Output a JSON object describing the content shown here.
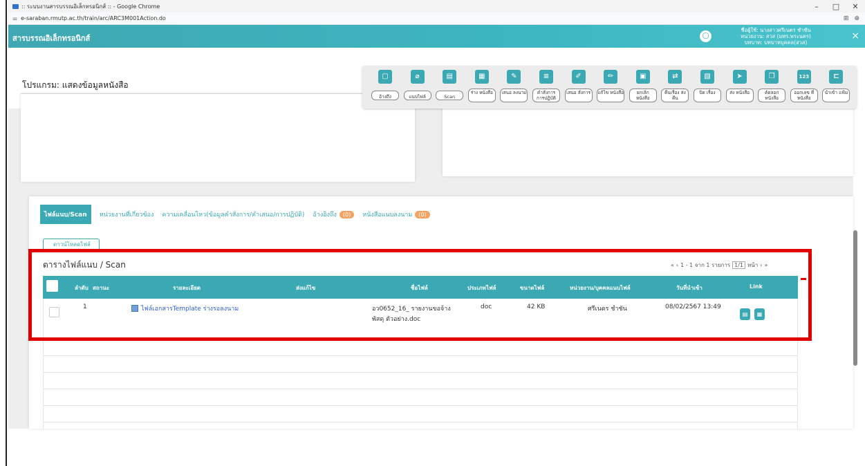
{
  "browser": {
    "title": ":: ระบบงานสารบรรณอิเล็กทรอนิกส์ :: - Google Chrome",
    "url": "e-saraban.rmutp.ac.th/train/arc/ARC3M001Action.do"
  },
  "app": {
    "title": "สารบรรณอิเล็กทรอนิกส์",
    "user_line1": "ชื่อผู้ใช้: นางสาวศรีเนตร ชำชัน",
    "user_line2": "หน่วยงาน: สวส (มทร.พระนคร)",
    "user_line3": "บทบาท: บทบาทบุคคล(สวส)",
    "close": "×"
  },
  "program": {
    "title": "โปรแกรม: แสดงข้อมูลหนังสือ"
  },
  "toolbar": [
    {
      "icon": "copy-icon",
      "glyph": "▢",
      "label": "อ้างถึง"
    },
    {
      "icon": "paperclip-icon",
      "glyph": "⌀",
      "label": "แนบไฟล์"
    },
    {
      "icon": "scan-icon",
      "glyph": "▤",
      "label": "Scan"
    },
    {
      "icon": "document-icon",
      "glyph": "▦",
      "label": "ร่าง หนังสือ"
    },
    {
      "icon": "sign-icon",
      "glyph": "✎",
      "label": "เสนอ ลงนาม"
    },
    {
      "icon": "order-icon",
      "glyph": "≡",
      "label": "คำสั่งการ การปฏิบัติ"
    },
    {
      "icon": "propose-icon",
      "glyph": "✐",
      "label": "เสนอ สั่งการ"
    },
    {
      "icon": "edit-icon",
      "glyph": "✏",
      "label": "แก้ไข หนังสือ"
    },
    {
      "icon": "cancel-doc-icon",
      "glyph": "▣",
      "label": "ยกเลิก หนังสือ"
    },
    {
      "icon": "return-icon",
      "glyph": "⇄",
      "label": "คืนเรื่อง ส่งคืน"
    },
    {
      "icon": "close-doc-icon",
      "glyph": "▧",
      "label": "ปิด เรื่อง"
    },
    {
      "icon": "send-icon",
      "glyph": "➤",
      "label": "ส่ง หนังสือ"
    },
    {
      "icon": "duplicate-icon",
      "glyph": "❐",
      "label": "คัดลอก หนังสือ"
    },
    {
      "icon": "number-icon",
      "glyph": "123",
      "label": "ออกเลข ที่หนังสือ"
    },
    {
      "icon": "import-folder-icon",
      "glyph": "⊏",
      "label": "นำเข้า แฟ้ม"
    }
  ],
  "tabs": [
    {
      "label": "ไฟล์แนบ/Scan",
      "badge": ""
    },
    {
      "label": "หน่วยงานที่เกี่ยวข้อง",
      "badge": ""
    },
    {
      "label": "ความเคลื่อนไหว(ข้อมูลคำสั่งการ/คำเสนอ/การปฏิบัติ)",
      "badge": ""
    },
    {
      "label": "อ้างอิงถึง",
      "badge": "(0)"
    },
    {
      "label": "หนังสือแนบลงนาม",
      "badge": "(0)"
    }
  ],
  "refresh_label": "ดาวน์โหลดไฟล์",
  "table": {
    "title": "ตารางไฟล์แนบ / Scan",
    "pager": {
      "first": "«",
      "prev": "‹",
      "range": "1 - 1 จาก 1 รายการ",
      "page": "1/1",
      "page_suffix": "หน้า",
      "next": "›",
      "last": "»"
    },
    "headers": {
      "no": "ลำดับ",
      "status": "สถานะ",
      "detail": "รายละเอียด",
      "edit": "ส่งแก้ไข",
      "filename": "ชื่อไฟล์",
      "filetype": "ประเภทไฟล์",
      "filesize": "ขนาดไฟล์",
      "owner": "หน่วยงาน/บุคคลแนบไฟล์",
      "date": "วันที่นำเข้า",
      "link": "Link"
    },
    "rows": [
      {
        "no": "1",
        "detail": "ไฟล์เอกสารTemplate ร่างรอลงนาม",
        "filename_line1": "อว0652_16_ รายงานขอจ้าง",
        "filename_line2": "พัสดุ ตัวอย่าง.doc",
        "filetype": "doc",
        "filesize": "42 KB",
        "owner": "ศรีเนตร ชำชัน",
        "date": "08/02/2567 13:49"
      }
    ]
  }
}
